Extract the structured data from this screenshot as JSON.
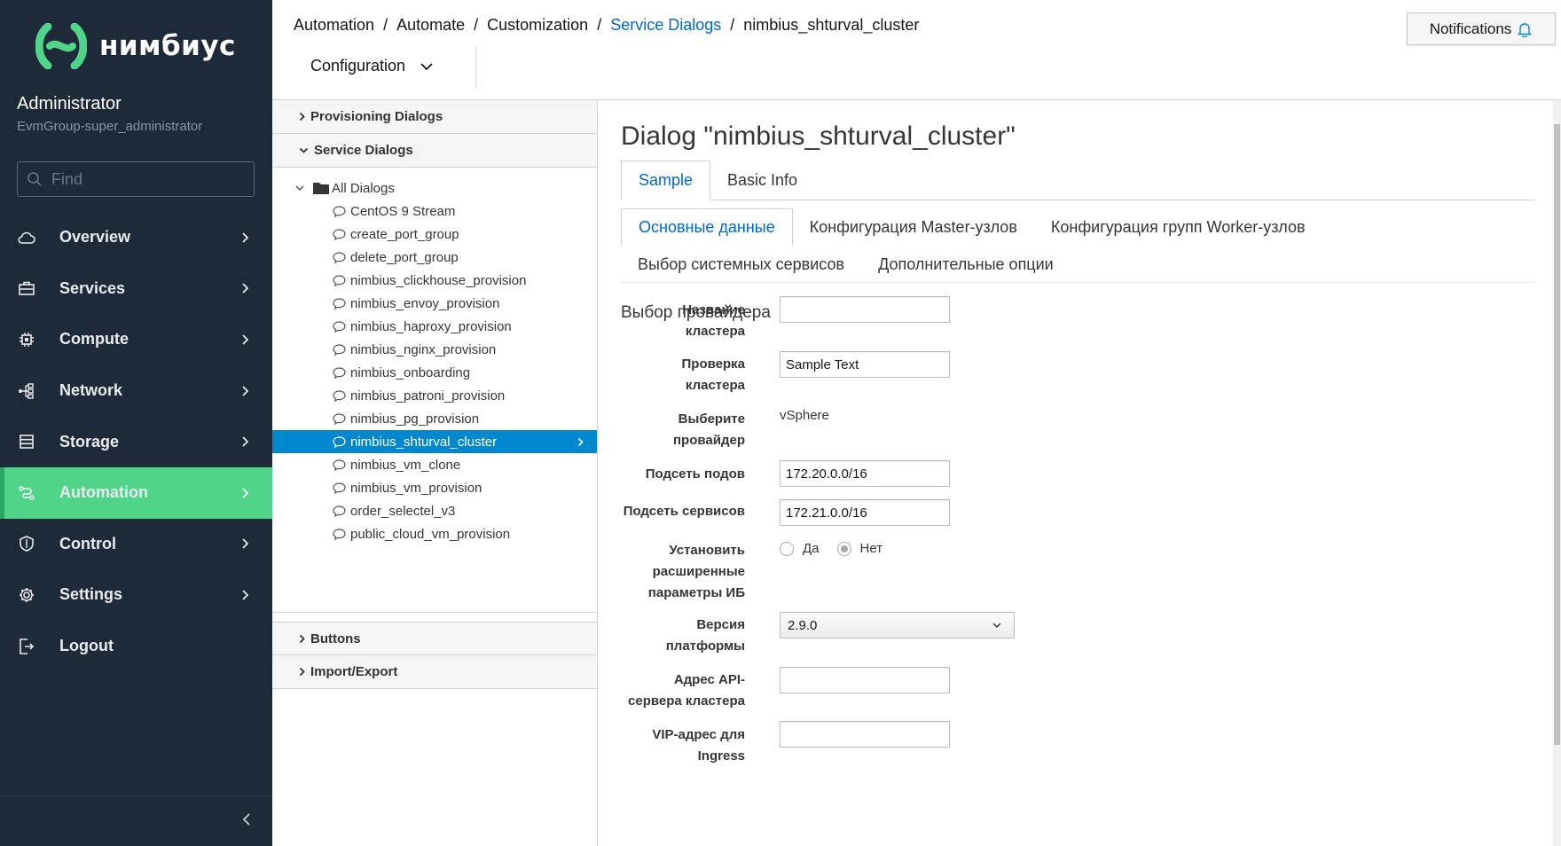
{
  "brand": {
    "name": "нимбиус",
    "accent": "#4fd48a",
    "sidebar_bg": "#1f2a38"
  },
  "user": {
    "name": "Administrator",
    "group": "EvmGroup-super_administrator"
  },
  "search": {
    "placeholder": "Find"
  },
  "nav": [
    {
      "label": "Overview",
      "icon": "cloud-icon"
    },
    {
      "label": "Services",
      "icon": "briefcase-icon"
    },
    {
      "label": "Compute",
      "icon": "chip-icon"
    },
    {
      "label": "Network",
      "icon": "network-icon"
    },
    {
      "label": "Storage",
      "icon": "database-icon"
    },
    {
      "label": "Automation",
      "icon": "automation-icon",
      "active": true
    },
    {
      "label": "Control",
      "icon": "shield-icon"
    },
    {
      "label": "Settings",
      "icon": "gear-icon"
    },
    {
      "label": "Logout",
      "icon": "logout-icon"
    }
  ],
  "breadcrumb": [
    "Automation",
    "Automate",
    "Customization",
    "Service Dialogs",
    "nimbius_shturval_cluster"
  ],
  "toolbar": {
    "configuration": "Configuration"
  },
  "notifications": {
    "label": "Notifications"
  },
  "accordion": {
    "provisioning": "Provisioning Dialogs",
    "service": "Service Dialogs",
    "buttons": "Buttons",
    "import_export": "Import/Export"
  },
  "tree": {
    "root": "All Dialogs",
    "items": [
      "CentOS 9 Stream",
      "create_port_group",
      "delete_port_group",
      "nimbius_clickhouse_provision",
      "nimbius_envoy_provision",
      "nimbius_haproxy_provision",
      "nimbius_nginx_provision",
      "nimbius_onboarding",
      "nimbius_patroni_provision",
      "nimbius_pg_provision",
      "nimbius_shturval_cluster",
      "nimbius_vm_clone",
      "nimbius_vm_provision",
      "order_selectel_v3",
      "public_cloud_vm_provision"
    ],
    "selected": "nimbius_shturval_cluster"
  },
  "main": {
    "title": "Dialog \"nimbius_shturval_cluster\"",
    "tabs": [
      "Sample",
      "Basic Info"
    ],
    "subtabs": [
      "Основные данные",
      "Конфигурация Master-узлов",
      "Конфигурация групп Worker-узлов",
      "Выбор системных сервисов",
      "Дополнительные опции"
    ],
    "section": "Выбор провайдера",
    "fields": {
      "cluster_name": {
        "label": "Название кластера",
        "value": ""
      },
      "cluster_check": {
        "label": "Проверка кластера",
        "value": "Sample Text"
      },
      "provider": {
        "label": "Выберите провайдер",
        "value": "vSphere"
      },
      "pod_subnet": {
        "label": "Подсеть подов",
        "value": "172.20.0.0/16"
      },
      "service_subnet": {
        "label": "Подсеть сервисов",
        "value": "172.21.0.0/16"
      },
      "security": {
        "label": "Установить расширенные параметры ИБ",
        "yes": "Да",
        "no": "Нет",
        "selected": "Нет"
      },
      "platform_version": {
        "label": "Версия платформы",
        "value": "2.9.0"
      },
      "api_address": {
        "label": "Адрес API-сервера кластера",
        "value": ""
      },
      "vip_ingress": {
        "label": "VIP-адрес для Ingress",
        "value": ""
      }
    }
  }
}
